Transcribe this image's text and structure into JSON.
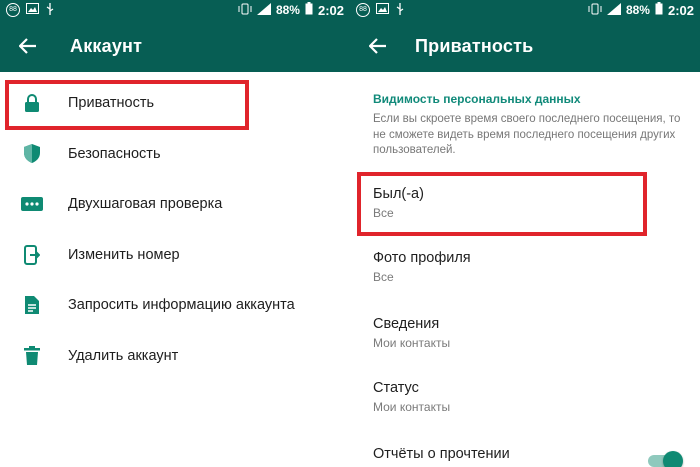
{
  "status_bar": {
    "notification_badge": "88",
    "battery": "88%",
    "time": "2:02"
  },
  "colors": {
    "toolbar": "#075e54",
    "accent": "#118a7a",
    "highlight": "#e0242b",
    "icon": "#0f8a73"
  },
  "left": {
    "title": "Аккаунт",
    "items": [
      {
        "label": "Приватность",
        "icon": "lock-icon"
      },
      {
        "label": "Безопасность",
        "icon": "shield-icon"
      },
      {
        "label": "Двухшаговая проверка",
        "icon": "dots-icon"
      },
      {
        "label": "Изменить номер",
        "icon": "phone-change-icon"
      },
      {
        "label": "Запросить информацию аккаунта",
        "icon": "document-icon"
      },
      {
        "label": "Удалить аккаунт",
        "icon": "trash-icon"
      }
    ]
  },
  "right": {
    "title": "Приватность",
    "section_header": "Видимость персональных данных",
    "section_desc": "Если вы скроете время своего последнего посещения, то не сможете видеть время последнего посещения других пользователей.",
    "settings": [
      {
        "title": "Был(-а)",
        "value": "Все"
      },
      {
        "title": "Фото профиля",
        "value": "Все"
      },
      {
        "title": "Сведения",
        "value": "Мои контакты"
      },
      {
        "title": "Статус",
        "value": "Мои контакты"
      },
      {
        "title": "Отчёты о прочтении",
        "value": ""
      }
    ],
    "read_receipts_enabled": true
  }
}
